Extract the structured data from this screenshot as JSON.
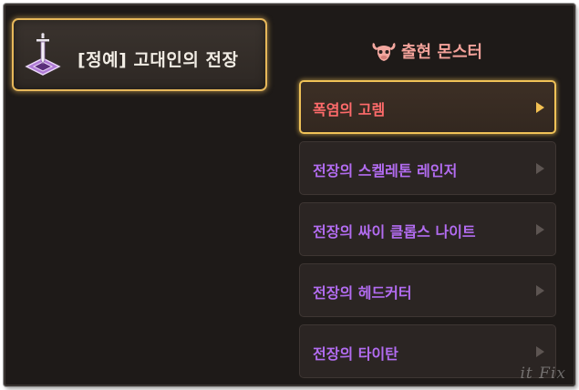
{
  "location": {
    "title": "[정예] 고대인의 전장",
    "icon": "dungeon-sword-emblem-icon"
  },
  "monsters_panel": {
    "header_icon": "bull-skull-icon",
    "header": "출현 몬스터",
    "items": [
      {
        "name": "폭염의 고렘",
        "selected": true
      },
      {
        "name": "전장의 스켈레톤 레인저",
        "selected": false
      },
      {
        "name": "전장의 싸이 클롭스 나이트",
        "selected": false
      },
      {
        "name": "전장의 헤드커터",
        "selected": false
      },
      {
        "name": "전장의 타이탄",
        "selected": false
      }
    ]
  },
  "watermark": "it Fix",
  "colors": {
    "selected_border": "#f0c257",
    "selected_name": "#ff6b6b",
    "monster_name": "#b26cf0",
    "header_text": "#f4a29a"
  }
}
